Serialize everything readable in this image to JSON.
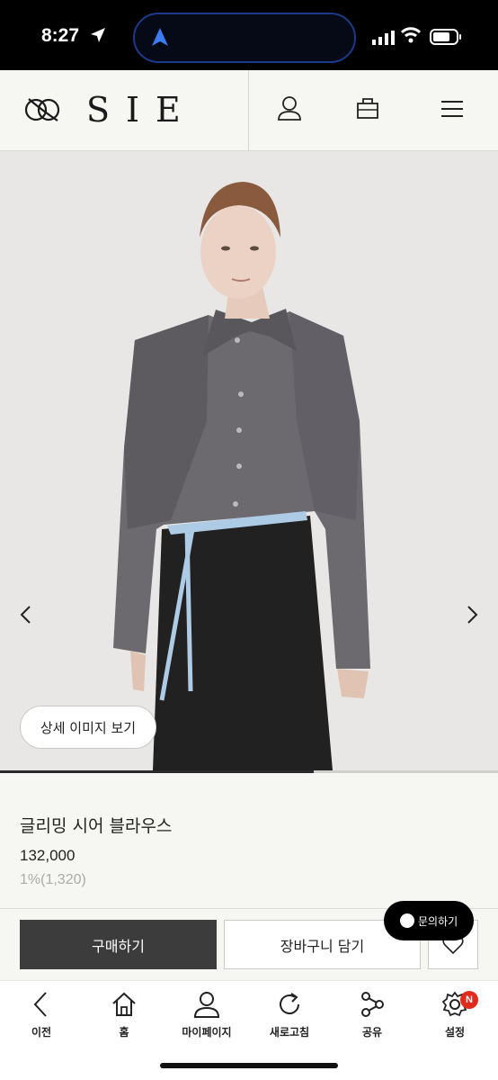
{
  "status_bar": {
    "time": "8:27"
  },
  "header": {
    "brand": "SIE",
    "icons": [
      "user-icon",
      "bag-icon",
      "menu-icon"
    ]
  },
  "gallery": {
    "detail_button": "상세 이미지 보기",
    "progress": 0.63
  },
  "product": {
    "title": "글리밍 시어 블라우스",
    "price": "132,000",
    "points": "1%(1,320)"
  },
  "actions": {
    "buy": "구매하기",
    "cart": "장바구니 담기",
    "inquiry": "문의하기"
  },
  "tabbar": {
    "items": [
      {
        "label": "이전",
        "icon": "back-icon"
      },
      {
        "label": "홈",
        "icon": "home-icon"
      },
      {
        "label": "마이페이지",
        "icon": "user-icon"
      },
      {
        "label": "새로고침",
        "icon": "refresh-icon"
      },
      {
        "label": "공유",
        "icon": "share-icon"
      },
      {
        "label": "설정",
        "icon": "settings-icon"
      }
    ],
    "settings_badge": "N"
  }
}
